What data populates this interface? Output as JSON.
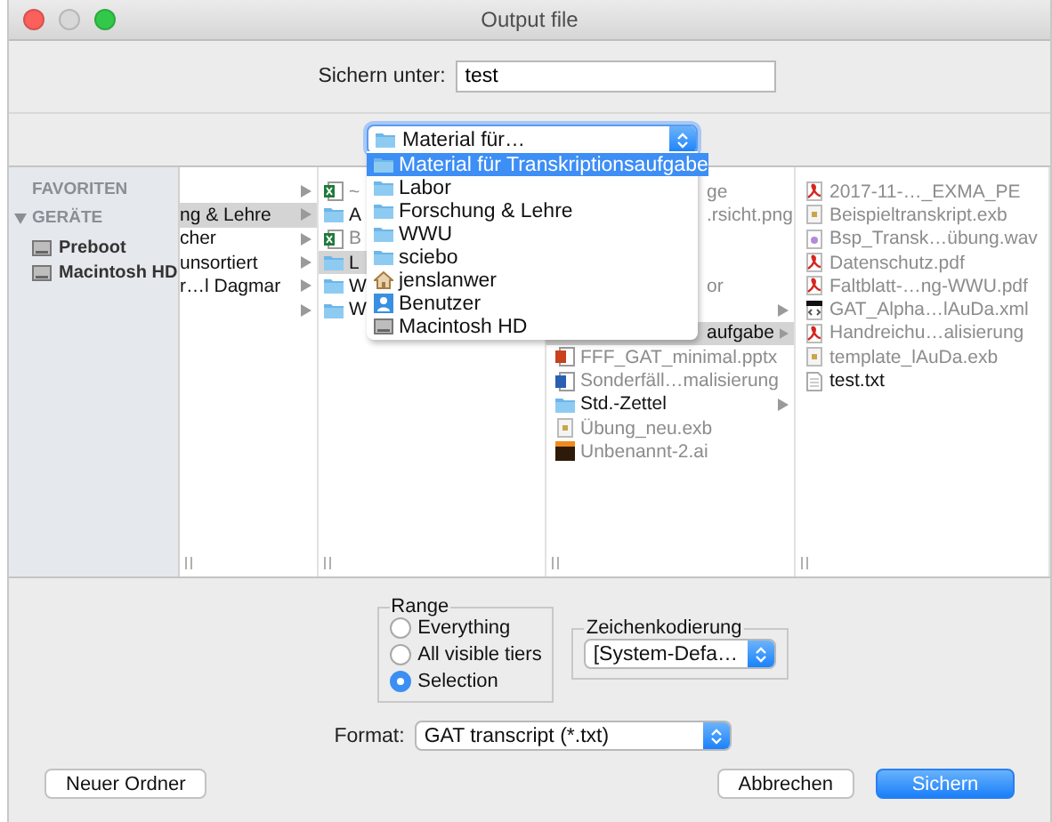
{
  "window": {
    "title": "Output file"
  },
  "save_as": {
    "label": "Sichern unter:",
    "value": "test"
  },
  "location_popup": {
    "value": "Material für…"
  },
  "location_menu": [
    {
      "label": "Material für Transkriptionsaufgabe",
      "kind": "folder",
      "selected": true
    },
    {
      "label": "Labor",
      "kind": "folder",
      "selected": false
    },
    {
      "label": "Forschung & Lehre",
      "kind": "folder",
      "selected": false
    },
    {
      "label": "WWU",
      "kind": "folder",
      "selected": false
    },
    {
      "label": "sciebo",
      "kind": "folder",
      "selected": false
    },
    {
      "label": "jenslanwer",
      "kind": "home",
      "selected": false
    },
    {
      "label": "Benutzer",
      "kind": "user",
      "selected": false
    },
    {
      "label": "Macintosh HD",
      "kind": "disk",
      "selected": false
    }
  ],
  "sidebar": {
    "sections": [
      {
        "title": "FAVORITEN",
        "expanded": false
      },
      {
        "title": "GERÄTE",
        "expanded": true,
        "items": [
          "Preboot",
          "Macintosh HD"
        ]
      }
    ]
  },
  "columns": [
    [
      {
        "arrow": true,
        "selected": false
      },
      {
        "name": "ng & Lehre",
        "arrow": true,
        "selected": true
      },
      {
        "name": "cher",
        "arrow": true,
        "selected": false
      },
      {
        "name": "unsortiert",
        "arrow": true,
        "selected": false
      },
      {
        "name": "r…l Dagmar",
        "arrow": true,
        "selected": false
      },
      {
        "arrow": true,
        "selected": false
      }
    ],
    [
      {
        "name": "~",
        "kind": "excel",
        "selected": false,
        "disabled": true
      },
      {
        "name": "A",
        "kind": "folder",
        "selected": false,
        "disabled": false
      },
      {
        "name": "B",
        "kind": "excel",
        "selected": false,
        "disabled": true
      },
      {
        "name": "L",
        "kind": "folder",
        "selected": true,
        "disabled": false
      },
      {
        "name": "W",
        "kind": "folder",
        "selected": false,
        "disabled": false
      },
      {
        "name": "W",
        "kind": "folder",
        "selected": false,
        "disabled": false
      }
    ],
    [
      {
        "name": "ge",
        "kind": "covered",
        "selected": false,
        "disabled": true
      },
      {
        "name": ".rsicht.png",
        "kind": "covered",
        "selected": false,
        "disabled": true
      },
      {
        "kind": "covered",
        "selected": false
      },
      {
        "kind": "covered",
        "selected": false
      },
      {
        "name": "or",
        "kind": "covered",
        "selected": false,
        "disabled": true
      },
      {
        "kind": "covered",
        "arrow": true,
        "selected": false
      },
      {
        "name": "aufgabe",
        "kind": "covered",
        "arrow": true,
        "selected": true,
        "disabled": false
      },
      {
        "name": "FFF_GAT_minimal.pptx",
        "kind": "pptx",
        "selected": false,
        "disabled": true
      },
      {
        "name": "Sonderfäll…malisierung",
        "kind": "word",
        "selected": false,
        "disabled": true
      },
      {
        "name": "Std.-Zettel",
        "kind": "folder",
        "arrow": true,
        "selected": false,
        "disabled": false
      },
      {
        "name": "Übung_neu.exb",
        "kind": "exb",
        "selected": false,
        "disabled": true
      },
      {
        "name": "Unbenannt-2.ai",
        "kind": "ai",
        "selected": false,
        "disabled": true
      }
    ],
    [
      {
        "name": "2017-11-…_EXMA_PE",
        "kind": "pdf",
        "selected": false,
        "disabled": true
      },
      {
        "name": "Beispieltranskript.exb",
        "kind": "exb",
        "selected": false,
        "disabled": true
      },
      {
        "name": "Bsp_Transk…übung.wav",
        "kind": "wav",
        "selected": false,
        "disabled": true
      },
      {
        "name": "Datenschutz.pdf",
        "kind": "pdf",
        "selected": false,
        "disabled": true
      },
      {
        "name": "Faltblatt-…ng-WWU.pdf",
        "kind": "pdf",
        "selected": false,
        "disabled": true
      },
      {
        "name": "GAT_Alpha…lAuDa.xml",
        "kind": "xml",
        "selected": false,
        "disabled": true
      },
      {
        "name": "Handreichu…alisierung",
        "kind": "pdf",
        "selected": false,
        "disabled": true
      },
      {
        "name": "template_lAuDa.exb",
        "kind": "exb",
        "selected": false,
        "disabled": true
      },
      {
        "name": "test.txt",
        "kind": "txt",
        "selected": false,
        "disabled": false
      }
    ]
  ],
  "range": {
    "title": "Range",
    "options": [
      {
        "label": "Everything",
        "selected": false
      },
      {
        "label": "All visible tiers",
        "selected": false
      },
      {
        "label": "Selection",
        "selected": true
      }
    ]
  },
  "encoding": {
    "title": "Zeichenkodierung",
    "value": "[System-Defa…"
  },
  "format": {
    "label": "Format:",
    "value": "GAT transcript (*.txt)"
  },
  "buttons": [
    {
      "label": "Neuer Ordner",
      "kind": "normal"
    },
    {
      "label": "Abbrechen",
      "kind": "normal"
    },
    {
      "label": "Sichern",
      "kind": "default"
    }
  ]
}
